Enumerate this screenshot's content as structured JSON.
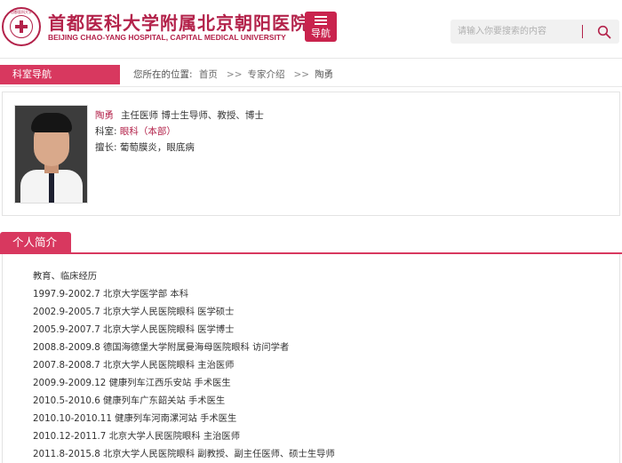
{
  "header": {
    "seal_text": "首都医科大学",
    "title_cn": "首都医科大学附属北京朝阳医院",
    "title_en": "BEIJING CHAO-YANG HOSPITAL, CAPITAL MEDICAL UNIVERSITY",
    "nav_label": "导航",
    "search_placeholder": "请输入你要搜索的内容"
  },
  "breadcrumb": {
    "dept_nav": "科室导航",
    "prefix": "您所在的位置:",
    "items": [
      "首页",
      "专家介绍",
      "陶勇"
    ],
    "separator": ">>"
  },
  "doctor": {
    "name": "陶勇",
    "titles": "主任医师 博士生导师、教授、博士",
    "dept_label": "科室:",
    "dept_value": "眼科（本部）",
    "specialty_label": "擅长:",
    "specialty_value": "葡萄膜炎，眼底病"
  },
  "profile": {
    "heading": "个人简介",
    "lines": [
      "教育、临床经历",
      "1997.9-2002.7 北京大学医学部 本科",
      "2002.9-2005.7 北京大学人民医院眼科 医学硕士",
      "2005.9-2007.7 北京大学人民医院眼科 医学博士",
      "2008.8-2009.8 德国海德堡大学附属曼海母医院眼科 访问学者",
      "2007.8-2008.7 北京大学人民医院眼科 主治医师",
      "2009.9-2009.12 健康列车江西乐安站 手术医生",
      "2010.5-2010.6 健康列车广东韶关站 手术医生",
      "2010.10-2010.11 健康列车河南漯河站 手术医生",
      "2010.12-2011.7 北京大学人民医院眼科 主治医师",
      "2011.8-2015.8 北京大学人民医院眼科 副教授、副主任医师、硕士生导师"
    ]
  },
  "colors": {
    "brand": "#b3224a",
    "accent": "#d8385f"
  }
}
